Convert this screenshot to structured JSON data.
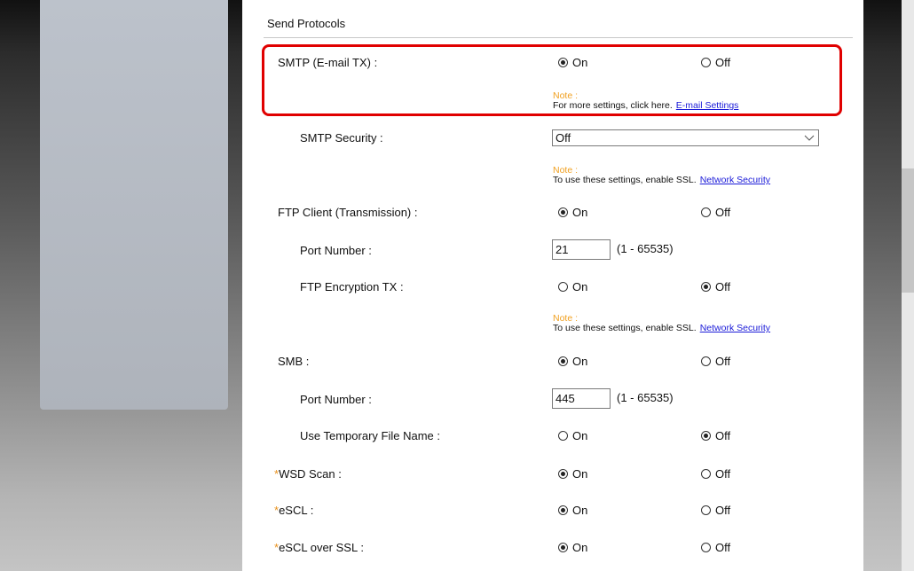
{
  "section": {
    "title": "Send Protocols"
  },
  "smtp": {
    "label": "SMTP (E-mail TX) :",
    "on": "On",
    "off": "Off",
    "note_label": "Note :",
    "note_text": "For more settings, click here.",
    "note_link": "E-mail Settings"
  },
  "smtp_security": {
    "label": "SMTP Security :",
    "value": "Off",
    "note_label": "Note :",
    "note_text": "To use these settings, enable SSL.",
    "note_link": "Network Security"
  },
  "ftp_client": {
    "label": "FTP Client (Transmission) :",
    "on": "On",
    "off": "Off"
  },
  "ftp_port": {
    "label": "Port Number :",
    "value": "21",
    "range": "(1 - 65535)"
  },
  "ftp_encryption": {
    "label": "FTP Encryption TX :",
    "on": "On",
    "off": "Off",
    "note_label": "Note :",
    "note_text": "To use these settings, enable SSL.",
    "note_link": "Network Security"
  },
  "smb": {
    "label": "SMB :",
    "on": "On",
    "off": "Off"
  },
  "smb_port": {
    "label": "Port Number :",
    "value": "445",
    "range": "(1 - 65535)"
  },
  "temp_file": {
    "label": "Use Temporary File Name :",
    "on": "On",
    "off": "Off"
  },
  "wsd_scan": {
    "star": "*",
    "label": "WSD Scan :",
    "on": "On",
    "off": "Off"
  },
  "escl": {
    "star": "*",
    "label": "eSCL :",
    "on": "On",
    "off": "Off"
  },
  "escl_ssl": {
    "star": "*",
    "label": "eSCL over SSL :",
    "on": "On",
    "off": "Off"
  },
  "colors": {
    "highlight": "#e00000",
    "note": "#f0a020",
    "link": "#1a1ad8",
    "required_star": "#e8901c"
  }
}
